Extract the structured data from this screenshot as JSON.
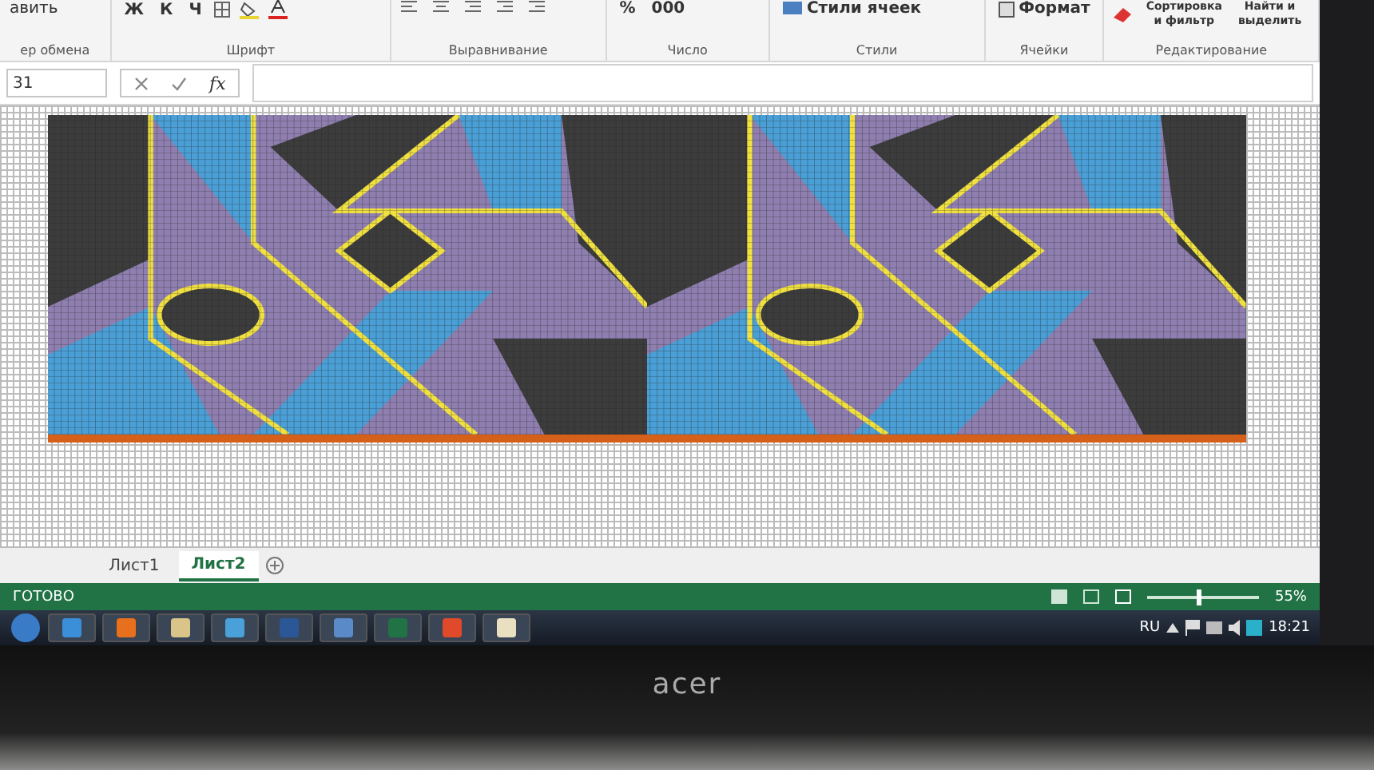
{
  "ribbon": {
    "clipboard": {
      "paste_label": "авить",
      "group_label": "ер обмена"
    },
    "font": {
      "buttons": [
        "Ж",
        "К",
        "Ч"
      ],
      "group_label": "Шрифт"
    },
    "alignment": {
      "group_label": "Выравнивание"
    },
    "number": {
      "buttons": [
        "%",
        "000"
      ],
      "group_label": "Число"
    },
    "styles": {
      "button": "Стили ячеек",
      "group_label": "Стили"
    },
    "cells": {
      "button": "Формат",
      "group_label": "Ячейки"
    },
    "editing": {
      "sort_lines": [
        "Сортировка",
        "и фильтр"
      ],
      "find_lines": [
        "Найти и",
        "выделить"
      ],
      "group_label": "Редактирование"
    }
  },
  "formula_bar": {
    "name_box": "31",
    "fx": "fx"
  },
  "sheet_tabs": [
    {
      "label": "Лист1",
      "selected": false
    },
    {
      "label": "Лист2",
      "selected": true
    }
  ],
  "status_bar": {
    "status": "ГОТОВО",
    "zoom": "55%",
    "zoom_slider": {
      "level": 0.45
    }
  },
  "taskbar": {
    "language": "RU",
    "time": "18:21"
  },
  "monitor": {
    "brand": "acer"
  }
}
